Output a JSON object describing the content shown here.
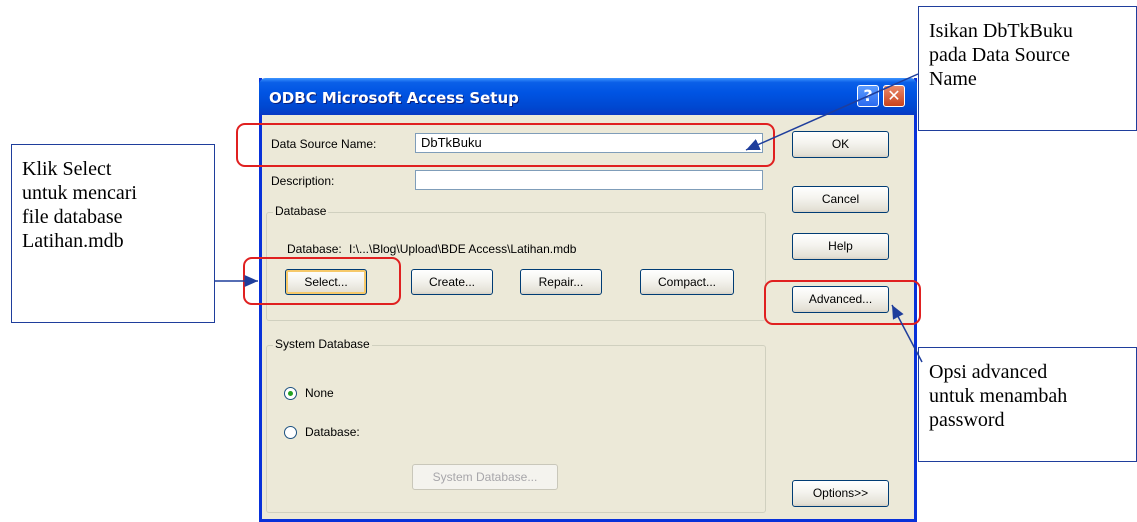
{
  "dialog": {
    "title": "ODBC Microsoft Access Setup",
    "help_glyph": "?",
    "close_glyph": "✕",
    "data_source_name_label": "Data Source Name:",
    "data_source_name_value": "DbTkBuku",
    "description_label": "Description:",
    "description_value": "",
    "database_group_label": "Database",
    "database_path_label": "Database:",
    "database_path_value": "I:\\...\\Blog\\Upload\\BDE Access\\Latihan.mdb",
    "buttons": {
      "ok": "OK",
      "cancel": "Cancel",
      "help": "Help",
      "advanced": "Advanced...",
      "options": "Options>>",
      "select": "Select...",
      "create": "Create...",
      "repair": "Repair...",
      "compact": "Compact..."
    },
    "system_database_group_label": "System Database",
    "radio_none_label": "None",
    "radio_database_label": "Database:",
    "system_database_button": "System Database...",
    "selected_radio": "None"
  },
  "callouts": {
    "top_right": [
      "Isikan DbTkBuku",
      "pada Data Source",
      "Name"
    ],
    "left": [
      "Klik Select",
      "untuk mencari",
      "file database",
      "Latihan.mdb"
    ],
    "bottom_right": [
      "Opsi advanced",
      "untuk menambah",
      "password"
    ]
  },
  "colors": {
    "title_bar": "#0054e3",
    "highlight": "#e02020",
    "arrow": "#1f3e9c",
    "dialog_bg": "#ece9d8"
  },
  "icons": [
    "help-icon",
    "close-icon",
    "radio-selected-icon",
    "radio-unselected-icon"
  ]
}
